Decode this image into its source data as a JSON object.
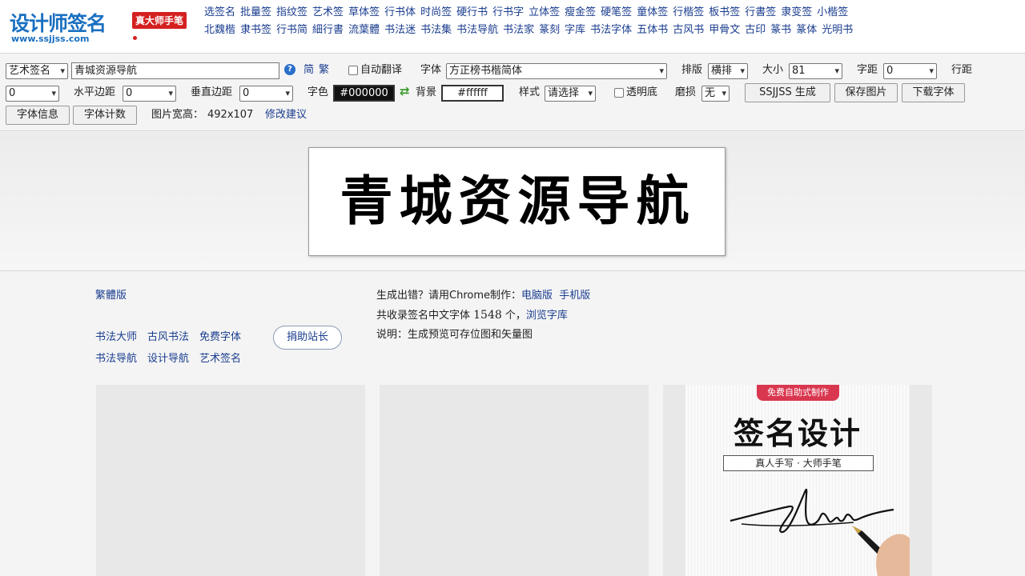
{
  "header": {
    "logo_text": "设计师签名",
    "logo_badge": "真大师手笔",
    "logo_url": "www.ssjjss.com",
    "nav_row1": [
      "选签名",
      "批量签",
      "指纹签",
      "艺术签",
      "草体签",
      "行书体",
      "时尚签",
      "硬行书",
      "行书字",
      "立体签",
      "瘦金签",
      "硬笔签",
      "童体签",
      "行楷签",
      "板书签",
      "行書签",
      "隶变签",
      "小楷签"
    ],
    "nav_row2": [
      "北魏楷",
      "隶书签",
      "行书简",
      "細行書",
      "流葉體",
      "书法迷",
      "书法集",
      "书法导航",
      "书法家",
      "篆刻",
      "字库",
      "书法字体",
      "五体书",
      "古风书",
      "甲骨文",
      "古印",
      "篆书",
      "篆体",
      "光明书"
    ]
  },
  "toolbar": {
    "type_select": "艺术签名",
    "text_input": "青城资源导航",
    "simplified": "简",
    "traditional": "繁",
    "auto_translate": "自动翻译",
    "font_label": "字体",
    "font_select": "方正榜书楷简体",
    "layout_label": "排版",
    "layout_select": "横排",
    "size_label": "大小",
    "size_select": "81",
    "spacing_label": "字距",
    "spacing_select": "0",
    "line_label": "行距",
    "line_select": "0",
    "hmargin_label": "水平边距",
    "hmargin_select": "0",
    "vmargin_label": "垂直边距",
    "vmargin_select": "0",
    "color_label": "字色",
    "color_value": "#000000",
    "bg_label": "背景",
    "bg_value": "#ffffff",
    "style_label": "样式",
    "style_select": "请选择",
    "transparent_label": "透明底",
    "wear_label": "磨损",
    "wear_select": "无",
    "generate_btn": "SSJJSS 生成",
    "save_btn": "保存图片",
    "download_btn": "下载字体",
    "font_info_btn": "字体信息",
    "font_count_btn": "字体计数",
    "image_size_label": "图片宽高：",
    "image_size_value": "492x107",
    "suggest_link": "修改建议"
  },
  "preview": {
    "text": "青城资源导航"
  },
  "info": {
    "traditional_link": "繁體版",
    "links_row1": [
      "书法大师",
      "古风书法",
      "免费字体"
    ],
    "links_row2": [
      "书法导航",
      "设计导航",
      "艺术签名"
    ],
    "donate": "捐助站长",
    "line1_prefix": "生成出错？请用Chrome制作：",
    "line1_link1": "电脑版",
    "line1_link2": "手机版",
    "line2_prefix": "共收录签名中文字体 ",
    "line2_count": "1548",
    "line2_suffix": " 个，",
    "line2_link": "浏览字库",
    "line3": "说明：生成预览可存位图和矢量图"
  },
  "ad": {
    "ribbon": "免费自助式制作",
    "title": "签名设计",
    "subtitle": "真人手写 · 大师手笔"
  },
  "colors": {
    "link": "#1a3d8f",
    "brand_blue": "#1a6fc0",
    "brand_red": "#d42020"
  }
}
